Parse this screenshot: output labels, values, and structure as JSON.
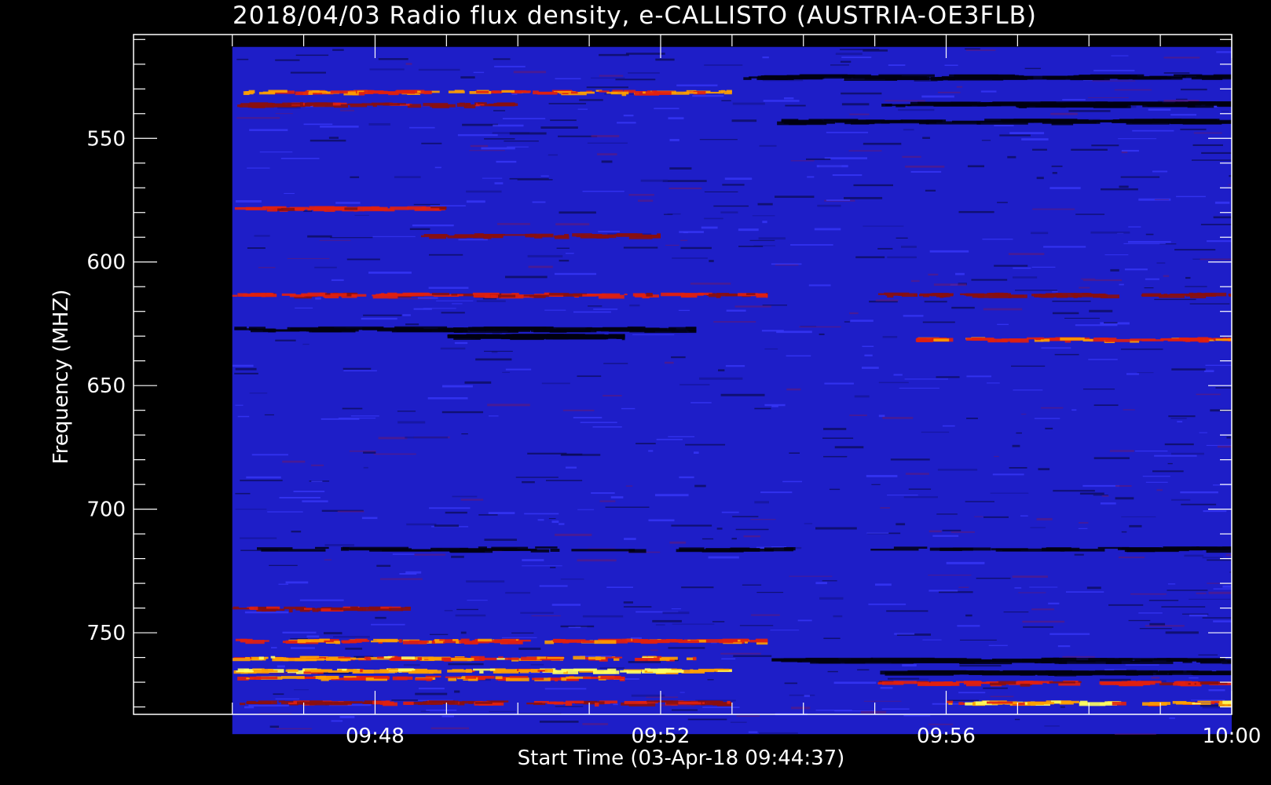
{
  "chart_data": {
    "type": "heatmap",
    "title": "2018/04/03  Radio flux density, e-CALLISTO (AUSTRIA-OE3FLB)",
    "xlabel": "Start Time (03-Apr-18 09:44:37)",
    "ylabel": "Frequency (MHZ)",
    "x_unit": "minutes (UT clock time)",
    "xlim": [
      "09:44:37",
      "10:00:00"
    ],
    "data_x_range": [
      "09:46:00",
      "10:00:00"
    ],
    "ylim": [
      783,
      508
    ],
    "data_y_range": [
      791,
      513
    ],
    "y_axis_inverted": true,
    "x_ticks": [
      {
        "label": "09:48",
        "minute": 48
      },
      {
        "label": "09:52",
        "minute": 52
      },
      {
        "label": "09:56",
        "minute": 56
      },
      {
        "label": "10:00",
        "minute": 60
      }
    ],
    "y_ticks": [
      {
        "label": "550",
        "value": 550
      },
      {
        "label": "600",
        "value": 600
      },
      {
        "label": "650",
        "value": 650
      },
      {
        "label": "700",
        "value": 700
      },
      {
        "label": "750",
        "value": 750
      }
    ],
    "colormap": [
      "#000000",
      "#2020ff",
      "#8a1010",
      "#e02010",
      "#ffa000",
      "#ffff60"
    ],
    "background_color": "#1e1ec8",
    "bright_bands": [
      {
        "freq_mhz": 531,
        "t_start": 46.0,
        "t_end": 53.0,
        "intensity": 0.85
      },
      {
        "freq_mhz": 536,
        "t_start": 46.0,
        "t_end": 50.0,
        "intensity": 0.55
      },
      {
        "freq_mhz": 578,
        "t_start": 46.0,
        "t_end": 49.0,
        "intensity": 0.7
      },
      {
        "freq_mhz": 589,
        "t_start": 48.5,
        "t_end": 52.0,
        "intensity": 0.45
      },
      {
        "freq_mhz": 613,
        "t_start": 46.0,
        "t_end": 53.5,
        "intensity": 0.65
      },
      {
        "freq_mhz": 613,
        "t_start": 55.0,
        "t_end": 60.0,
        "intensity": 0.5
      },
      {
        "freq_mhz": 631,
        "t_start": 55.5,
        "t_end": 60.0,
        "intensity": 0.8
      },
      {
        "freq_mhz": 740,
        "t_start": 46.0,
        "t_end": 48.5,
        "intensity": 0.55
      },
      {
        "freq_mhz": 753,
        "t_start": 46.0,
        "t_end": 53.5,
        "intensity": 0.8
      },
      {
        "freq_mhz": 760,
        "t_start": 46.0,
        "t_end": 52.5,
        "intensity": 0.9
      },
      {
        "freq_mhz": 765,
        "t_start": 46.0,
        "t_end": 53.0,
        "intensity": 1.0
      },
      {
        "freq_mhz": 768,
        "t_start": 46.0,
        "t_end": 51.5,
        "intensity": 0.85
      },
      {
        "freq_mhz": 770,
        "t_start": 55.0,
        "t_end": 60.0,
        "intensity": 0.7
      },
      {
        "freq_mhz": 778,
        "t_start": 46.0,
        "t_end": 53.0,
        "intensity": 0.6
      },
      {
        "freq_mhz": 778,
        "t_start": 56.0,
        "t_end": 60.0,
        "intensity": 0.95
      }
    ],
    "dark_bands": [
      {
        "freq_mhz": 525,
        "t_start": 53.0,
        "t_end": 60.0
      },
      {
        "freq_mhz": 536,
        "t_start": 55.0,
        "t_end": 60.0
      },
      {
        "freq_mhz": 543,
        "t_start": 53.5,
        "t_end": 60.0
      },
      {
        "freq_mhz": 627,
        "t_start": 46.0,
        "t_end": 52.5
      },
      {
        "freq_mhz": 630,
        "t_start": 49.0,
        "t_end": 51.5
      },
      {
        "freq_mhz": 716,
        "t_start": 46.0,
        "t_end": 60.0
      },
      {
        "freq_mhz": 761,
        "t_start": 53.5,
        "t_end": 60.0
      },
      {
        "freq_mhz": 766,
        "t_start": 55.0,
        "t_end": 60.0
      }
    ]
  }
}
